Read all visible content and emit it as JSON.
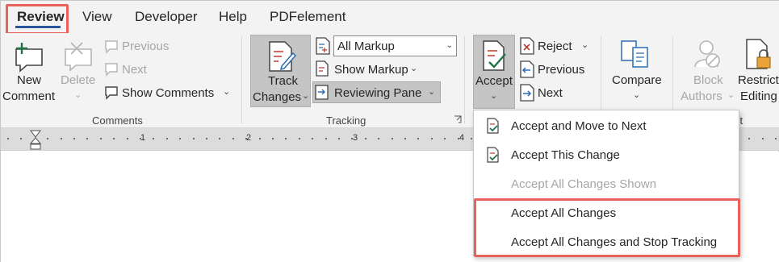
{
  "tabs": [
    "Review",
    "View",
    "Developer",
    "Help",
    "PDFelement"
  ],
  "comments_group": {
    "new_comment_1": "New",
    "new_comment_2": "Comment",
    "delete": "Delete",
    "previous": "Previous",
    "next": "Next",
    "show_comments": "Show Comments",
    "label": "Comments"
  },
  "tracking_group": {
    "track_changes_1": "Track",
    "track_changes_2": "Changes",
    "markup_select": "All Markup",
    "show_markup": "Show Markup",
    "reviewing_pane": "Reviewing Pane",
    "label": "Tracking"
  },
  "changes_group": {
    "accept": "Accept",
    "reject": "Reject",
    "previous": "Previous",
    "next": "Next"
  },
  "compare_group": {
    "compare": "Compare"
  },
  "protect_group": {
    "block_1": "Block",
    "block_2": "Authors",
    "restrict_1": "Restrict",
    "restrict_2": "Editing",
    "label_fragment": "ct"
  },
  "ruler": {
    "numbers": [
      "1",
      "2",
      "3",
      "4"
    ]
  },
  "accept_menu": {
    "items": [
      {
        "label": "Accept and Move to Next",
        "enabled": true
      },
      {
        "label": "Accept This Change",
        "enabled": true
      },
      {
        "label": "Accept All Changes Shown",
        "enabled": false
      },
      {
        "label": "Accept All Changes",
        "enabled": true
      },
      {
        "label": "Accept All Changes and Stop Tracking",
        "enabled": true
      }
    ]
  },
  "colors": {
    "highlight": "#e8615a",
    "tab_underline": "#2b579a",
    "accent_green": "#217346",
    "accent_red": "#c0392b",
    "accent_blue": "#2b6cb0"
  }
}
